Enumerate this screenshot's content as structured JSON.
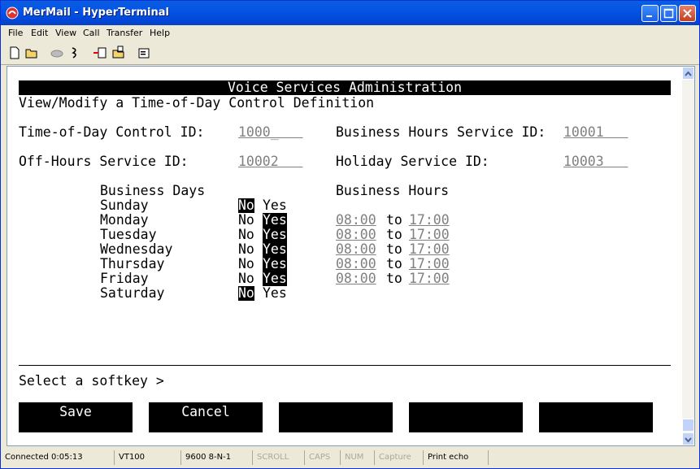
{
  "window": {
    "title": "MerMail - HyperTerminal"
  },
  "menu": [
    "File",
    "Edit",
    "View",
    "Call",
    "Transfer",
    "Help"
  ],
  "toolbar": [
    "new-icon",
    "open-icon",
    "disconnect-icon",
    "dial-icon",
    "send-icon",
    "receive-icon",
    "properties-icon"
  ],
  "screen": {
    "header": "Voice Services Administration",
    "subtitle": "View/Modify a Time-of-Day Control Definition",
    "tod_label": "Time-of-Day Control ID:",
    "tod_value": "1000_   ",
    "bh_label": "Business Hours Service ID:",
    "bh_value": "10001   ",
    "oh_label": "Off-Hours Service ID:",
    "oh_value": "10002   ",
    "hol_label": "Holiday Service ID:",
    "hol_value": "10003   ",
    "days_header": "Business Days",
    "hours_header": "Business Hours",
    "no": "No",
    "yes": "Yes",
    "to": "to",
    "days": [
      {
        "name": "Sunday",
        "business": false,
        "start": "",
        "end": ""
      },
      {
        "name": "Monday",
        "business": true,
        "start": "08:00",
        "end": "17:00"
      },
      {
        "name": "Tuesday",
        "business": true,
        "start": "08:00",
        "end": "17:00"
      },
      {
        "name": "Wednesday",
        "business": true,
        "start": "08:00",
        "end": "17:00"
      },
      {
        "name": "Thursday",
        "business": true,
        "start": "08:00",
        "end": "17:00"
      },
      {
        "name": "Friday",
        "business": true,
        "start": "08:00",
        "end": "17:00"
      },
      {
        "name": "Saturday",
        "business": false,
        "start": "",
        "end": ""
      }
    ],
    "prompt": "Select a softkey >",
    "softkeys": [
      "Save",
      "Cancel",
      "",
      "",
      ""
    ]
  },
  "status": {
    "connected": "Connected 0:05:13",
    "emulation": "VT100",
    "settings": "9600 8-N-1",
    "scroll": "SCROLL",
    "caps": "CAPS",
    "num": "NUM",
    "capture": "Capture",
    "print_echo": "Print echo"
  },
  "colors": {
    "title_bar": "#0554e4",
    "chrome": "#ece9d8",
    "terminal_bg": "#ffffff",
    "terminal_fg": "#000000"
  }
}
